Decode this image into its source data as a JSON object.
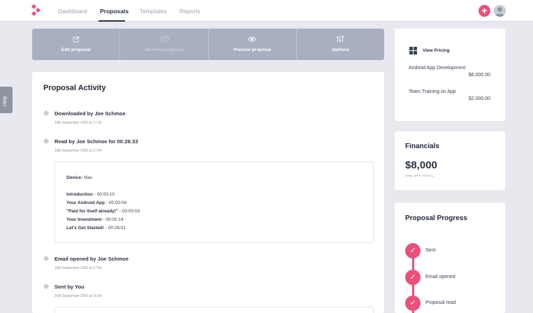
{
  "nav": {
    "items": [
      {
        "label": "Dashboard",
        "active": false
      },
      {
        "label": "Proposals",
        "active": true
      },
      {
        "label": "Templates",
        "active": false
      },
      {
        "label": "Reports",
        "active": false
      }
    ],
    "add_icon": "plus-icon",
    "avatar_icon": "user-avatar"
  },
  "help": {
    "label": "Help"
  },
  "toolbar": {
    "items": [
      {
        "label": "Edit proposal",
        "icon": "edit-icon",
        "enabled": true
      },
      {
        "label": "Re-send proposal",
        "icon": "mail-icon",
        "enabled": false
      },
      {
        "label": "Preview proposal",
        "icon": "eye-icon",
        "enabled": true
      },
      {
        "label": "Options",
        "icon": "sliders-icon",
        "enabled": true
      }
    ]
  },
  "activity": {
    "title": "Proposal Activity",
    "events": [
      {
        "title": "Downloaded by Joe Schmoe",
        "date": "16th September 2020 at 17:30"
      },
      {
        "title": "Read by Joe Schmoe for 00:26:33",
        "date": "16th September 2020 at 17:04"
      },
      {
        "title": "Email opened by Joe Schmoe",
        "date": "16th September 2020 at 17:04"
      },
      {
        "title": "Sent by You",
        "date": "16th September 2020 at 16:54"
      }
    ],
    "details": {
      "device_label": "Device:",
      "device_value": "Mac",
      "sections": [
        {
          "name": "Introduction",
          "time": "00:00:10"
        },
        {
          "name": "Your Android App",
          "time": "00:00:04"
        },
        {
          "name": "\"Paid for itself already!\"",
          "time": "00:00:03"
        },
        {
          "name": "Your Investment",
          "time": "00:00:14"
        },
        {
          "name": "Let's Get Started!",
          "time": "00:26:01"
        }
      ]
    }
  },
  "pricing": {
    "view_label": "View Pricing",
    "icon": "grid-icon",
    "items": [
      {
        "name": "Android App Development",
        "price": "$6,000.00"
      },
      {
        "name": "Team Training on App",
        "price": "$2,000.00"
      }
    ]
  },
  "financials": {
    "title": "Financials",
    "amount": "$8,000",
    "subtitle": "ONE OFF TOTAL:"
  },
  "progress": {
    "title": "Proposal Progress",
    "steps": [
      {
        "label": "Sent",
        "done": true
      },
      {
        "label": "Email opened",
        "done": true
      },
      {
        "label": "Proposal read",
        "done": true
      }
    ]
  },
  "colors": {
    "accent": "#e8517c",
    "toolbar": "#a7afc1",
    "background": "#e7e9ef"
  }
}
